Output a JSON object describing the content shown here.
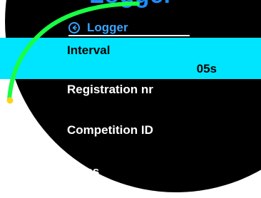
{
  "topFragmentText": "Logger",
  "header": {
    "icon": "back-arrow-icon",
    "title": "Logger"
  },
  "rows": {
    "interval": {
      "label": "Interval",
      "value": "05s"
    },
    "registration": {
      "label": "Registration nr"
    },
    "competition": {
      "label": "Competition ID"
    },
    "class": {
      "label": "Class"
    }
  },
  "scroll": {
    "position": 0.18
  },
  "colors": {
    "background": "#000000",
    "header": "#3aa3ff",
    "selectedRow": "#00e5ff",
    "text": "#ffffff",
    "selectedText": "#000000",
    "scrollbar": "#18ff44",
    "scrollThumb": "#ffd11a",
    "topFragment": "#1f8cff"
  }
}
